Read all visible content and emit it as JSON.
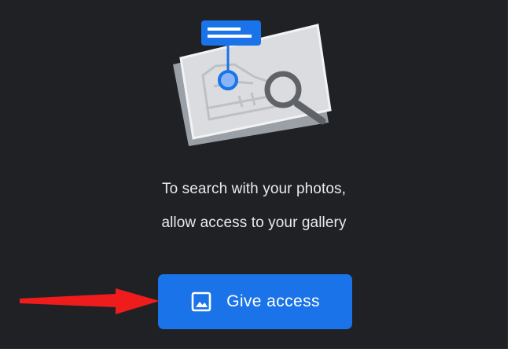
{
  "prompt": {
    "line1": "To search with your photos,",
    "line2": "allow access to your gallery"
  },
  "button": {
    "label": "Give access",
    "icon": "image-icon"
  },
  "illustration": {
    "icon": "photo-search-illustration"
  },
  "annotation": {
    "icon": "red-arrow-icon"
  },
  "colors": {
    "background": "#202124",
    "accent": "#1a73e8",
    "text": "#e8eaed",
    "annotation_arrow": "#ee1c1c"
  }
}
